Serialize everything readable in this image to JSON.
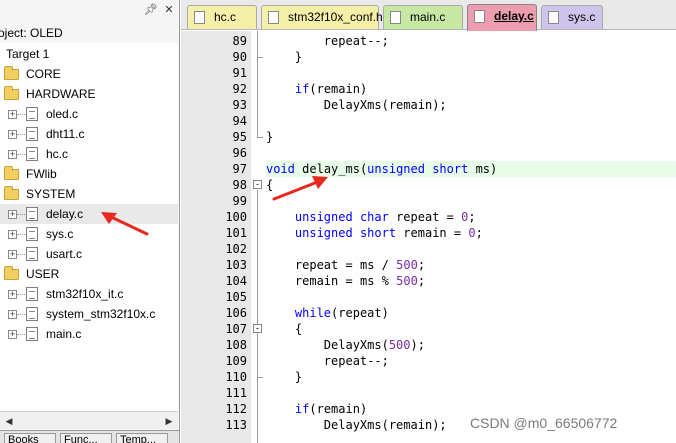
{
  "project_panel": {
    "title": "oject: OLED",
    "pin_icon": "pin-icon",
    "close_icon": "close-icon",
    "target": "Target 1",
    "groups": [
      {
        "name": "CORE",
        "files": []
      },
      {
        "name": "HARDWARE",
        "files": [
          "oled.c",
          "dht11.c",
          "hc.c"
        ]
      },
      {
        "name": "FWlib",
        "files": []
      },
      {
        "name": "SYSTEM",
        "files": [
          "delay.c",
          "sys.c",
          "usart.c"
        ]
      },
      {
        "name": "USER",
        "files": [
          "stm32f10x_it.c",
          "system_stm32f10x.c",
          "main.c"
        ]
      }
    ],
    "selected_file": "delay.c",
    "bottom_tabs": [
      "Books",
      "Func...",
      "Temp..."
    ]
  },
  "tabs": [
    {
      "label": "hc.c",
      "color": "#f5f0a8",
      "active": false
    },
    {
      "label": "stm32f10x_conf.h",
      "color": "#f5f0a8",
      "active": false
    },
    {
      "label": "main.c",
      "color": "#c7e8a3",
      "active": false
    },
    {
      "label": "delay.c",
      "color": "#ec9eb0",
      "active": true
    },
    {
      "label": "sys.c",
      "color": "#cfc4ec",
      "active": false
    }
  ],
  "editor": {
    "highlight_line": "97",
    "highlight_color": "#e6fbe8",
    "lines": [
      {
        "n": "89",
        "text": "        repeat--;"
      },
      {
        "n": "90",
        "text": "    }"
      },
      {
        "n": "91",
        "text": ""
      },
      {
        "n": "92",
        "text": "    if(remain)"
      },
      {
        "n": "93",
        "text": "        DelayXms(remain);"
      },
      {
        "n": "94",
        "text": ""
      },
      {
        "n": "95",
        "text": "}"
      },
      {
        "n": "96",
        "text": ""
      },
      {
        "n": "97",
        "text": "void delay_ms(unsigned short ms)"
      },
      {
        "n": "98",
        "text": "{"
      },
      {
        "n": "99",
        "text": ""
      },
      {
        "n": "100",
        "text": "    unsigned char repeat = 0;"
      },
      {
        "n": "101",
        "text": "    unsigned short remain = 0;"
      },
      {
        "n": "102",
        "text": ""
      },
      {
        "n": "103",
        "text": "    repeat = ms / 500;"
      },
      {
        "n": "104",
        "text": "    remain = ms % 500;"
      },
      {
        "n": "105",
        "text": ""
      },
      {
        "n": "106",
        "text": "    while(repeat)"
      },
      {
        "n": "107",
        "text": "    {"
      },
      {
        "n": "108",
        "text": "        DelayXms(500);"
      },
      {
        "n": "109",
        "text": "        repeat--;"
      },
      {
        "n": "110",
        "text": "    }"
      },
      {
        "n": "111",
        "text": ""
      },
      {
        "n": "112",
        "text": "    if(remain)"
      },
      {
        "n": "113",
        "text": "        DelayXms(remain);"
      }
    ],
    "keyword_color": "#0000ff",
    "number_color": "#7a2fa0"
  },
  "watermark": "CSDN @m0_66506772",
  "annotation_color": "#e8281c"
}
